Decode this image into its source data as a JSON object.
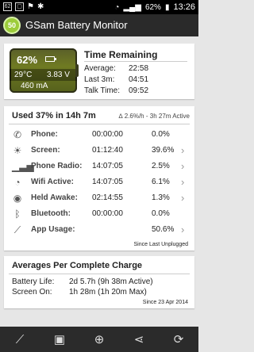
{
  "status_bar": {
    "left_badge": "62",
    "battery_pct": "62%",
    "time": "13:26"
  },
  "app_bar": {
    "logo_text": "50",
    "title": "GSam Battery Monitor"
  },
  "battery": {
    "percent": "62%",
    "temp": "29°C",
    "voltage": "3.83 V",
    "current": "460 mA"
  },
  "time_remaining": {
    "title": "Time Remaining",
    "rows": [
      {
        "label": "Average:",
        "value": "22:58"
      },
      {
        "label": "Last 3m:",
        "value": "04:51"
      },
      {
        "label": "Talk Time:",
        "value": "09:52"
      }
    ]
  },
  "usage": {
    "title": "Used 37% in 14h 7m",
    "subtitle": "∆ 2.6%/h - 3h 27m Active",
    "rows": [
      {
        "icon": "phone-icon",
        "glyph": "✆",
        "label": "Phone:",
        "time": "00:00:00",
        "pct": "0.0%",
        "chevron": false
      },
      {
        "icon": "screen-icon",
        "glyph": "☀",
        "label": "Screen:",
        "time": "01:12:40",
        "pct": "39.6%",
        "chevron": true
      },
      {
        "icon": "signal-icon",
        "glyph": "▁▃▅",
        "label": "Phone Radio:",
        "time": "14:07:05",
        "pct": "2.5%",
        "chevron": true
      },
      {
        "icon": "wifi-icon",
        "glyph": "◔",
        "label": "Wifi Active:",
        "time": "14:07:05",
        "pct": "6.1%",
        "chevron": true
      },
      {
        "icon": "awake-icon",
        "glyph": "◉",
        "label": "Held Awake:",
        "time": "02:14:55",
        "pct": "1.3%",
        "chevron": true
      },
      {
        "icon": "bluetooth-icon",
        "glyph": "ᛒ",
        "label": "Bluetooth:",
        "time": "00:00:00",
        "pct": "0.0%",
        "chevron": false
      },
      {
        "icon": "broom-icon",
        "glyph": "⟋",
        "label": "App Usage:",
        "time": "",
        "pct": "50.6%",
        "chevron": true
      }
    ],
    "note": "Since Last Unplugged"
  },
  "averages": {
    "title": "Averages Per Complete Charge",
    "rows": [
      {
        "label": "Battery Life:",
        "value": "2d 5.7h (9h 38m Active)"
      },
      {
        "label": "Screen On:",
        "value": "1h 28m (1h 20m Max)"
      }
    ],
    "note": "Since 23 Apr 2014"
  },
  "bottom_bar": [
    "broom-icon",
    "image-icon",
    "add-icon",
    "share-icon",
    "refresh-icon"
  ]
}
